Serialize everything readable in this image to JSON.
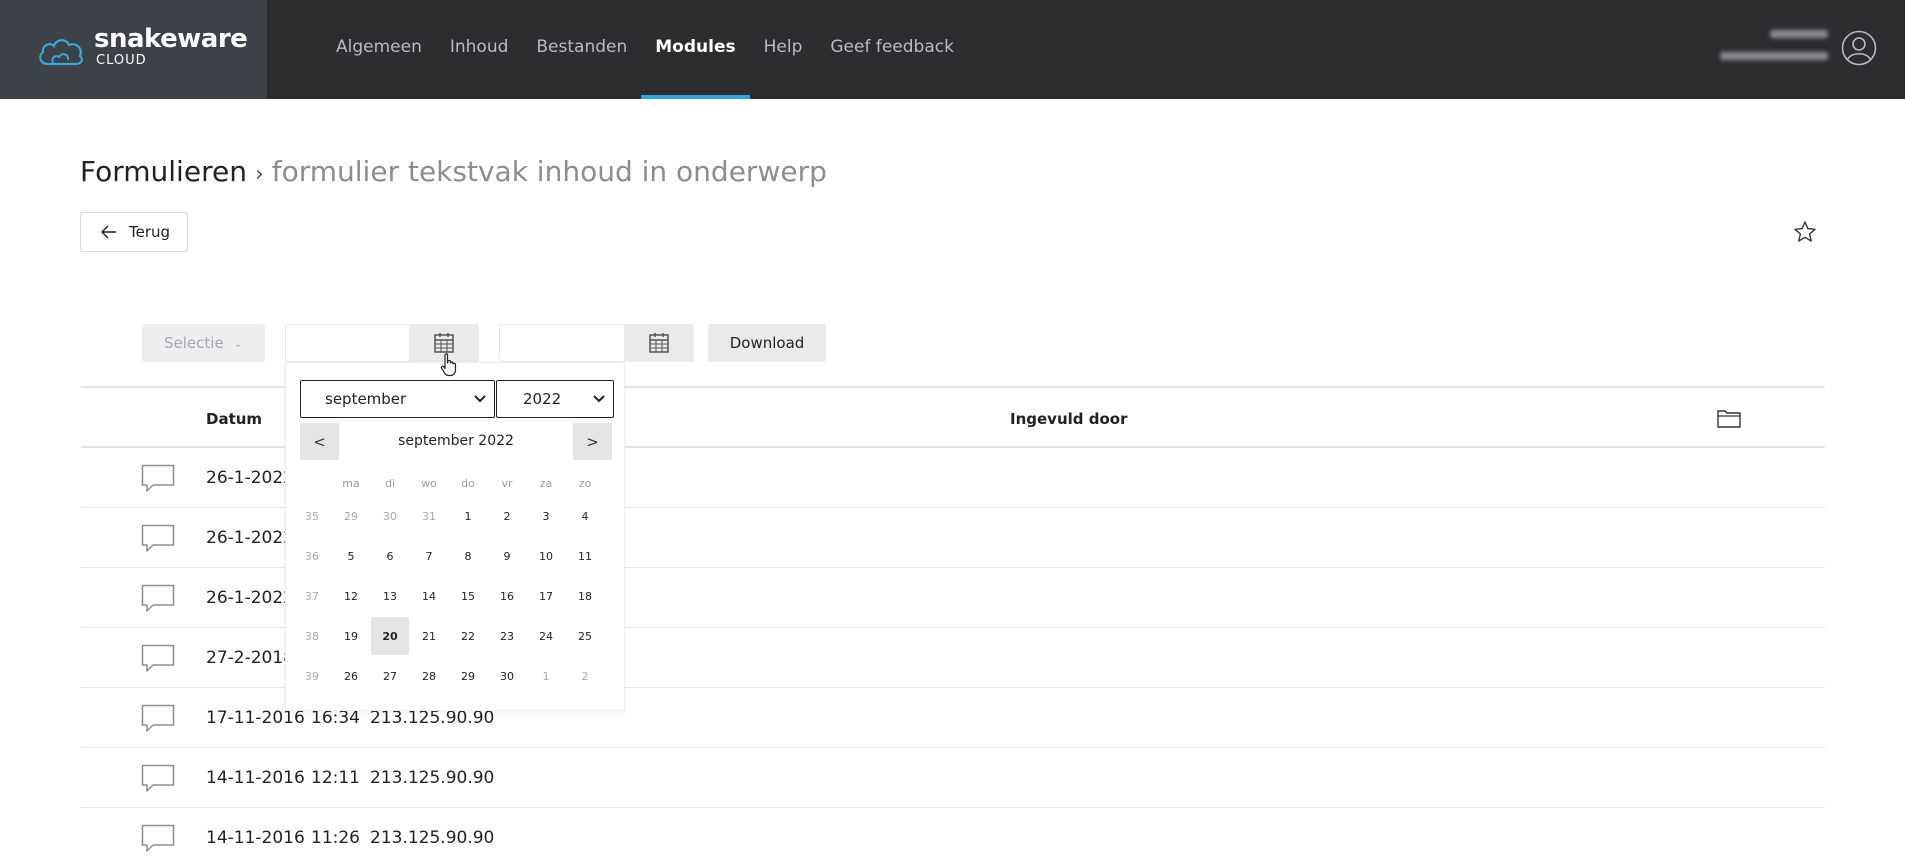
{
  "app": {
    "logo_text": "snakeware",
    "logo_sub": "CLOUD"
  },
  "nav": {
    "items": [
      {
        "label": "Algemeen"
      },
      {
        "label": "Inhoud"
      },
      {
        "label": "Bestanden"
      },
      {
        "label": "Modules",
        "active": true
      },
      {
        "label": "Help"
      },
      {
        "label": "Geef feedback"
      }
    ]
  },
  "page": {
    "title": "Formulieren",
    "separator": "›",
    "subtitle": "formulier tekstvak inhoud in onderwerp",
    "back_label": "Terug"
  },
  "toolbar": {
    "selection_label": "Selectie",
    "from_date": "",
    "to_date": "",
    "download_label": "Download"
  },
  "table": {
    "headers": {
      "date": "Datum",
      "filled_by": "Ingevuld door"
    },
    "rows": [
      {
        "date": "26-1-2022",
        "time": "",
        "ip": ""
      },
      {
        "date": "26-1-2022",
        "time": "",
        "ip": ""
      },
      {
        "date": "26-1-2022",
        "time": "",
        "ip": ""
      },
      {
        "date": "27-2-2018",
        "time": "",
        "ip": ""
      },
      {
        "date": "17-11-2016",
        "time": "16:34",
        "ip": "213.125.90.90"
      },
      {
        "date": "14-11-2016",
        "time": "12:11",
        "ip": "213.125.90.90"
      },
      {
        "date": "14-11-2016",
        "time": "11:26",
        "ip": "213.125.90.90"
      }
    ]
  },
  "datepicker": {
    "month_select": "september",
    "year_select": "2022",
    "prev": "<",
    "next": ">",
    "title": "september 2022",
    "weekdays": [
      "ma",
      "di",
      "wo",
      "do",
      "vr",
      "za",
      "zo"
    ],
    "weeks": [
      {
        "wk": "35",
        "days": [
          "29",
          "30",
          "31",
          "1",
          "2",
          "3",
          "4"
        ],
        "other": [
          true,
          true,
          true,
          false,
          false,
          false,
          false
        ]
      },
      {
        "wk": "36",
        "days": [
          "5",
          "6",
          "7",
          "8",
          "9",
          "10",
          "11"
        ],
        "other": [
          false,
          false,
          false,
          false,
          false,
          false,
          false
        ]
      },
      {
        "wk": "37",
        "days": [
          "12",
          "13",
          "14",
          "15",
          "16",
          "17",
          "18"
        ],
        "other": [
          false,
          false,
          false,
          false,
          false,
          false,
          false
        ]
      },
      {
        "wk": "38",
        "days": [
          "19",
          "20",
          "21",
          "22",
          "23",
          "24",
          "25"
        ],
        "other": [
          false,
          false,
          false,
          false,
          false,
          false,
          false
        ]
      },
      {
        "wk": "39",
        "days": [
          "26",
          "27",
          "28",
          "29",
          "30",
          "1",
          "2"
        ],
        "other": [
          false,
          false,
          false,
          false,
          false,
          true,
          true
        ]
      }
    ],
    "selected_day": "20"
  },
  "colors": {
    "topbar": "#2c2d2f",
    "logo_bg": "#3d4148",
    "accent": "#2aa6df"
  }
}
